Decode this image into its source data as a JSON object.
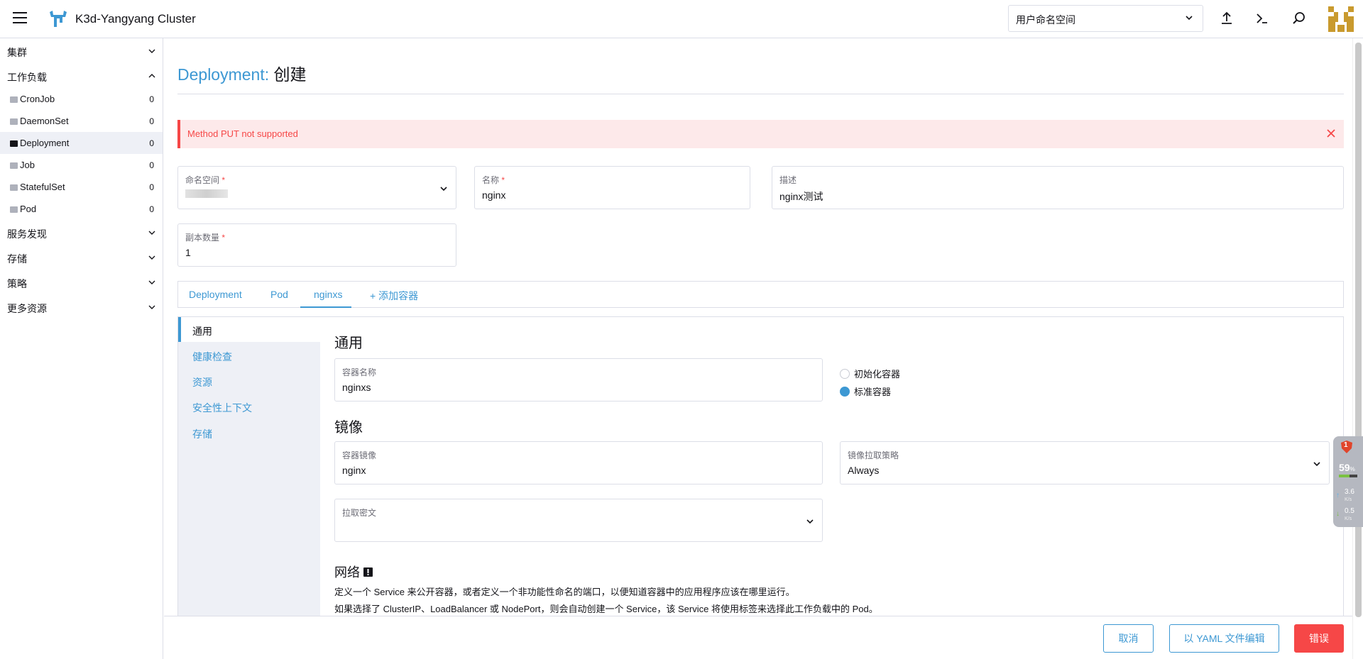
{
  "header": {
    "cluster_name": "K3d-Yangyang Cluster",
    "namespace_select": "用户命名空间"
  },
  "sidebar": {
    "groups": [
      {
        "label": "集群"
      },
      {
        "label": "工作负载"
      },
      {
        "label": "服务发现"
      },
      {
        "label": "存储"
      },
      {
        "label": "策略"
      },
      {
        "label": "更多资源"
      }
    ],
    "workload_items": [
      {
        "label": "CronJob",
        "count": "0"
      },
      {
        "label": "DaemonSet",
        "count": "0"
      },
      {
        "label": "Deployment",
        "count": "0"
      },
      {
        "label": "Job",
        "count": "0"
      },
      {
        "label": "StatefulSet",
        "count": "0"
      },
      {
        "label": "Pod",
        "count": "0"
      }
    ]
  },
  "page": {
    "title_type": "Deployment:",
    "title_action": "创建",
    "error_message": "Method PUT not supported"
  },
  "form": {
    "namespace": {
      "label": "命名空间",
      "required": "*"
    },
    "name": {
      "label": "名称",
      "required": "*",
      "value": "nginx"
    },
    "description": {
      "label": "描述",
      "value": "nginx测试"
    },
    "replicas": {
      "label": "副本数量",
      "required": "*",
      "value": "1"
    }
  },
  "tabs": [
    {
      "label": "Deployment"
    },
    {
      "label": "Pod"
    },
    {
      "label": "nginxs"
    },
    {
      "label": "+ 添加容器"
    }
  ],
  "side_tabs": [
    {
      "label": "通用"
    },
    {
      "label": "健康检查"
    },
    {
      "label": "资源"
    },
    {
      "label": "安全性上下文"
    },
    {
      "label": "存储"
    }
  ],
  "container": {
    "general_heading": "通用",
    "name_label": "容器名称",
    "name_value": "nginxs",
    "radio_init": "初始化容器",
    "radio_standard": "标准容器",
    "image_heading": "镜像",
    "image_label": "容器镜像",
    "image_value": "nginx",
    "pull_policy_label": "镜像拉取策略",
    "pull_policy_value": "Always",
    "pull_secret_label": "拉取密文",
    "network_heading": "网络",
    "network_desc_1": "定义一个 Service 来公开容器，或者定义一个非功能性命名的端口，以便知道容器中的应用程序应该在哪里运行。",
    "network_desc_2": "如果选择了 ClusterIP、LoadBalancer 或 NodePort，则会自动创建一个 Service，该 Service 将使用标签来选择此工作负载中的 Pod。"
  },
  "footer": {
    "cancel": "取消",
    "edit_yaml": "以 YAML 文件编辑",
    "error": "错误"
  },
  "widget": {
    "alerts": "1",
    "cpu_value": "59",
    "cpu_unit": "%",
    "cpu_fraction": 0.59,
    "up_speed": "3.6",
    "up_unit": "K/s",
    "down_speed": "0.5",
    "down_unit": "K/s"
  },
  "colors": {
    "accent": "#3d98d3",
    "error": "#f64747",
    "error_bg": "#fde9ea",
    "border": "#dcdee7",
    "sidebar_active_bg": "#eef0f6"
  },
  "icons": {
    "menu": "hamburger-icon",
    "logo": "rancher-logo-icon",
    "upload": "upload-icon",
    "shell": "terminal-icon",
    "search": "search-icon",
    "close": "close-icon",
    "chevron": "chevron-down-icon",
    "folder": "folder-icon",
    "info": "info-icon"
  }
}
